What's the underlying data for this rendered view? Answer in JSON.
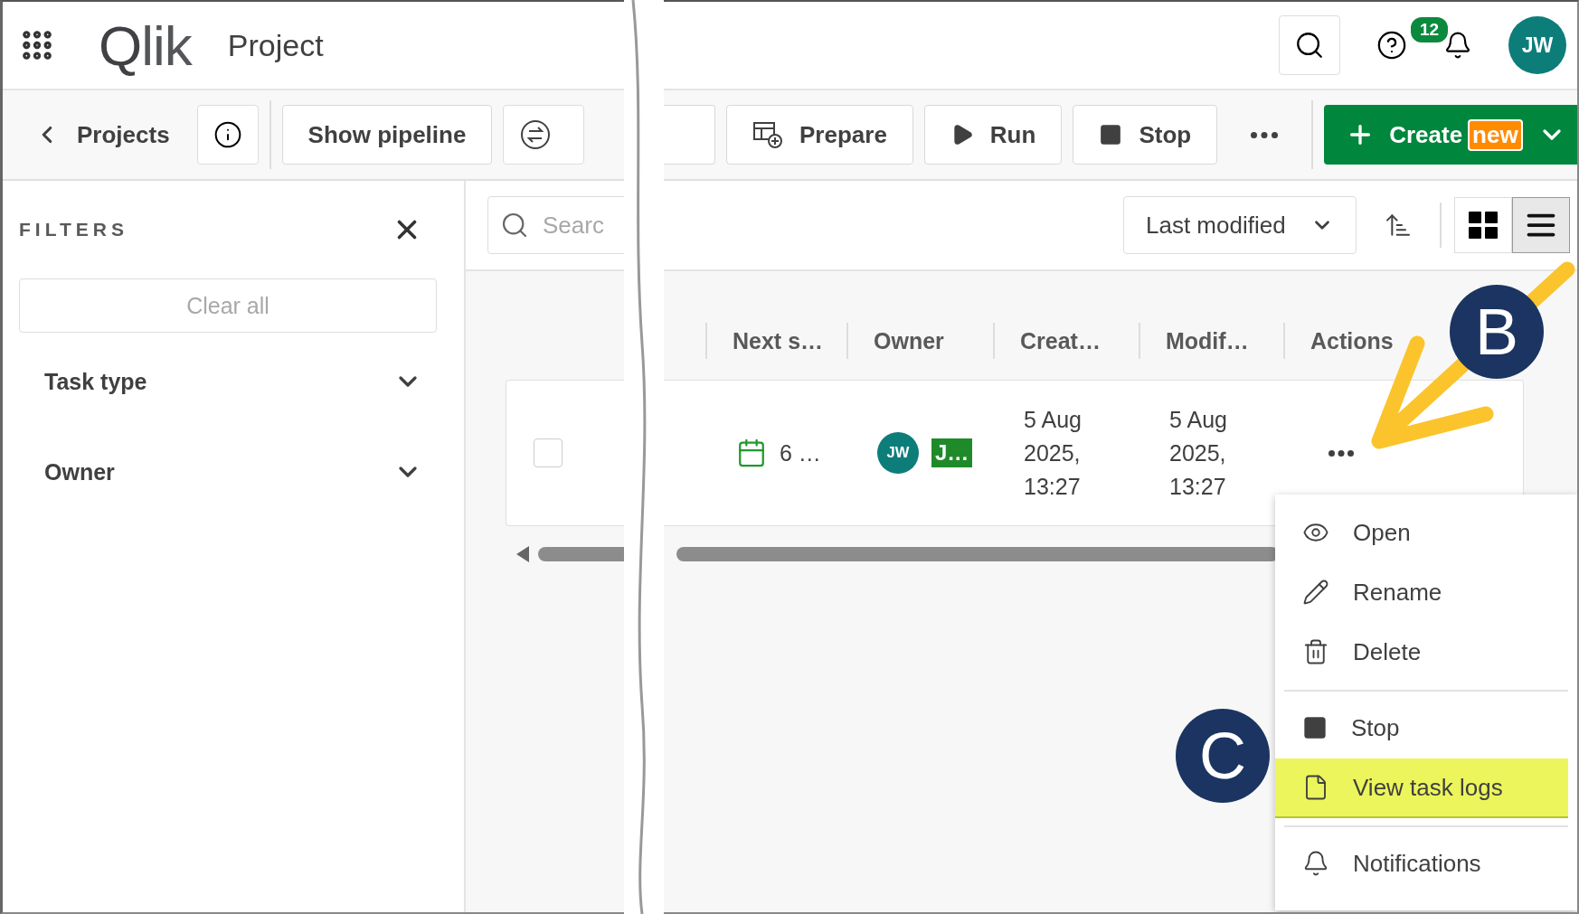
{
  "app_bar": {
    "logo": "Qlik",
    "title": "Project",
    "help_badge": "12",
    "avatar": "JW"
  },
  "toolbar": {
    "back": "Projects",
    "left_buttons": [
      {
        "label": "Show pipeline"
      }
    ],
    "right_buttons": [
      {
        "kind": "prepare",
        "label": "Prepare"
      },
      {
        "kind": "run",
        "label": "Run"
      },
      {
        "kind": "stop",
        "label": "Stop"
      }
    ],
    "create": {
      "label": "Create",
      "badge": "new"
    }
  },
  "filters": {
    "title": "FILTERS",
    "clear": "Clear all",
    "groups": [
      {
        "label": "Task type",
        "expanded": false
      },
      {
        "label": "Owner",
        "expanded": false
      }
    ]
  },
  "search": {
    "placeholder": "Searc"
  },
  "sort": {
    "label": "Last modified"
  },
  "view_toggle": [
    {
      "kind": "grid",
      "selected": false
    },
    {
      "kind": "list",
      "selected": true
    }
  ],
  "table": {
    "columns": [
      "Next s…",
      "Owner",
      "Creat…",
      "Modif…",
      "Actions"
    ],
    "rows": [
      {
        "checked": false,
        "next_run": "6 …",
        "owner_avatar": "JW",
        "owner_tag": "J…",
        "created": "5 Aug 2025, 13:27",
        "modified": "5 Aug 2025, 13:27"
      }
    ]
  },
  "menu": [
    {
      "kind": "open",
      "label": "Open",
      "selected": false,
      "divider_before": false
    },
    {
      "kind": "rename",
      "label": "Rename",
      "selected": false,
      "divider_before": false
    },
    {
      "kind": "delete",
      "label": "Delete",
      "selected": false,
      "divider_before": false
    },
    {
      "kind": "stop",
      "label": "Stop",
      "selected": false,
      "divider_before": true
    },
    {
      "kind": "logs",
      "label": "View task logs",
      "selected": true,
      "divider_before": false
    },
    {
      "kind": "notifications",
      "label": "Notifications",
      "selected": false,
      "divider_before": true
    }
  ],
  "annotations": [
    {
      "label": "B"
    },
    {
      "label": "C"
    }
  ]
}
